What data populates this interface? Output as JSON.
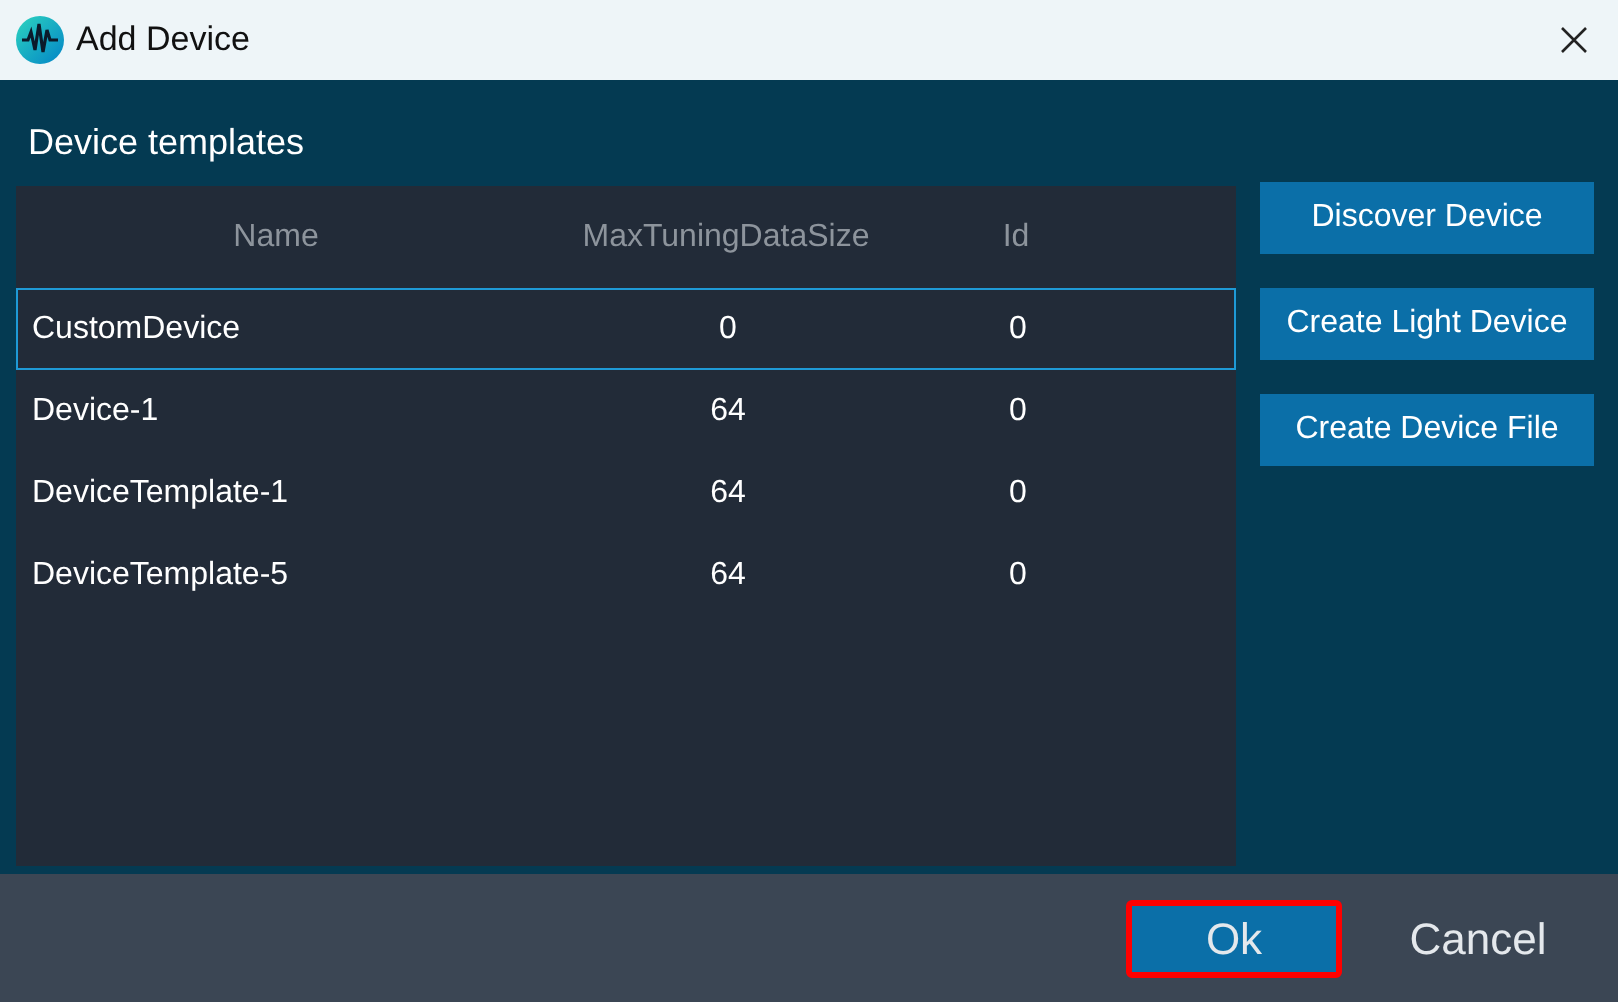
{
  "window": {
    "title": "Add Device"
  },
  "section_title": "Device templates",
  "table": {
    "columns": [
      "Name",
      "MaxTuningDataSize",
      "Id"
    ],
    "rows": [
      {
        "cells": [
          "CustomDevice",
          "0",
          "0"
        ],
        "selected": true
      },
      {
        "cells": [
          "Device-1",
          "64",
          "0"
        ],
        "selected": false
      },
      {
        "cells": [
          "DeviceTemplate-1",
          "64",
          "0"
        ],
        "selected": false
      },
      {
        "cells": [
          "DeviceTemplate-5",
          "64",
          "0"
        ],
        "selected": false
      }
    ]
  },
  "side_buttons": [
    "Discover Device",
    "Create Light Device",
    "Create Device File"
  ],
  "footer_buttons": [
    {
      "label": "Ok",
      "kind": "primary",
      "highlighted": true
    },
    {
      "label": "Cancel",
      "kind": "plain",
      "highlighted": false
    }
  ]
}
